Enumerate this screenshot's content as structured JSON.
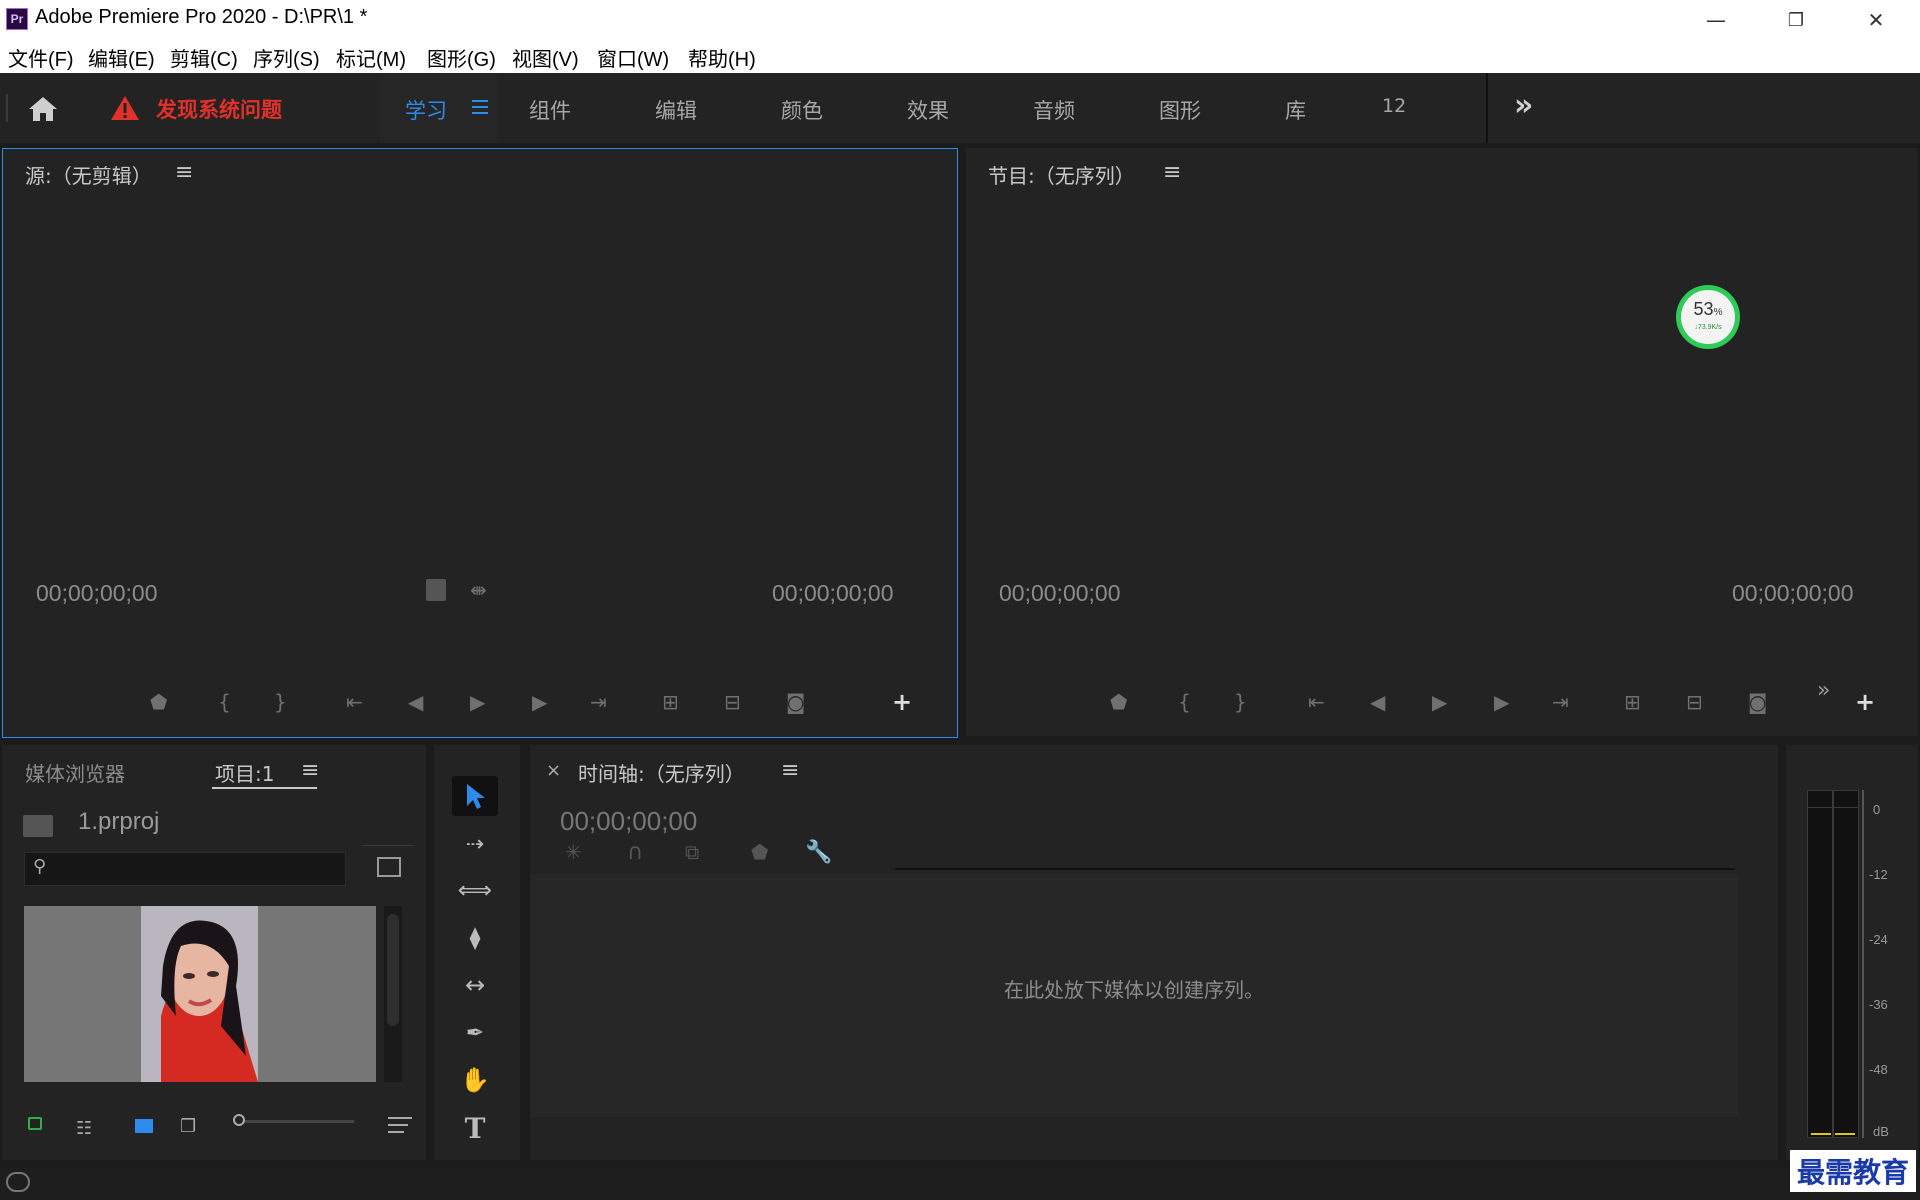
{
  "window": {
    "app_icon": "Pr",
    "title": "Adobe Premiere Pro 2020 - D:\\PR\\1 *",
    "minimize": "—",
    "restore": "❐",
    "close": "✕"
  },
  "menu": [
    "文件(F)",
    "编辑(E)",
    "剪辑(C)",
    "序列(S)",
    "标记(M)",
    "图形(G)",
    "视图(V)",
    "窗口(W)",
    "帮助(H)"
  ],
  "workspace": {
    "warning": "发现系统问题",
    "tabs": [
      "学习",
      "组件",
      "编辑",
      "颜色",
      "效果",
      "音频",
      "图形",
      "库",
      "12"
    ],
    "active_tab": "学习",
    "overflow": "»"
  },
  "source_monitor": {
    "title": "源:（无剪辑）",
    "timecode_in": "00;00;00;00",
    "timecode_out": "00;00;00;00"
  },
  "program_monitor": {
    "title": "节目:（无序列）",
    "timecode_in": "00;00;00;00",
    "timecode_out": "00;00;00;00",
    "overflow": "»"
  },
  "net_widget": {
    "percent": "53",
    "percent_unit": "%",
    "speed": "↓73.9K/s"
  },
  "project_panel": {
    "tab_media_browser": "媒体浏览器",
    "tab_project": "项目:1",
    "file_name": "1.prproj",
    "search_placeholder": ""
  },
  "timeline": {
    "close": "×",
    "title": "时间轴:（无序列）",
    "timecode": "00;00;00;00",
    "empty_message": "在此处放下媒体以创建序列。"
  },
  "audio_meter": {
    "labels": [
      "0",
      "-12",
      "-24",
      "-36",
      "-48",
      "dB"
    ]
  },
  "watermark": "最需教育",
  "colors": {
    "accent_blue": "#2d8ceb",
    "warning_red": "#e2302a",
    "panel_bg": "#232323",
    "app_bg": "#1b1b1b"
  }
}
